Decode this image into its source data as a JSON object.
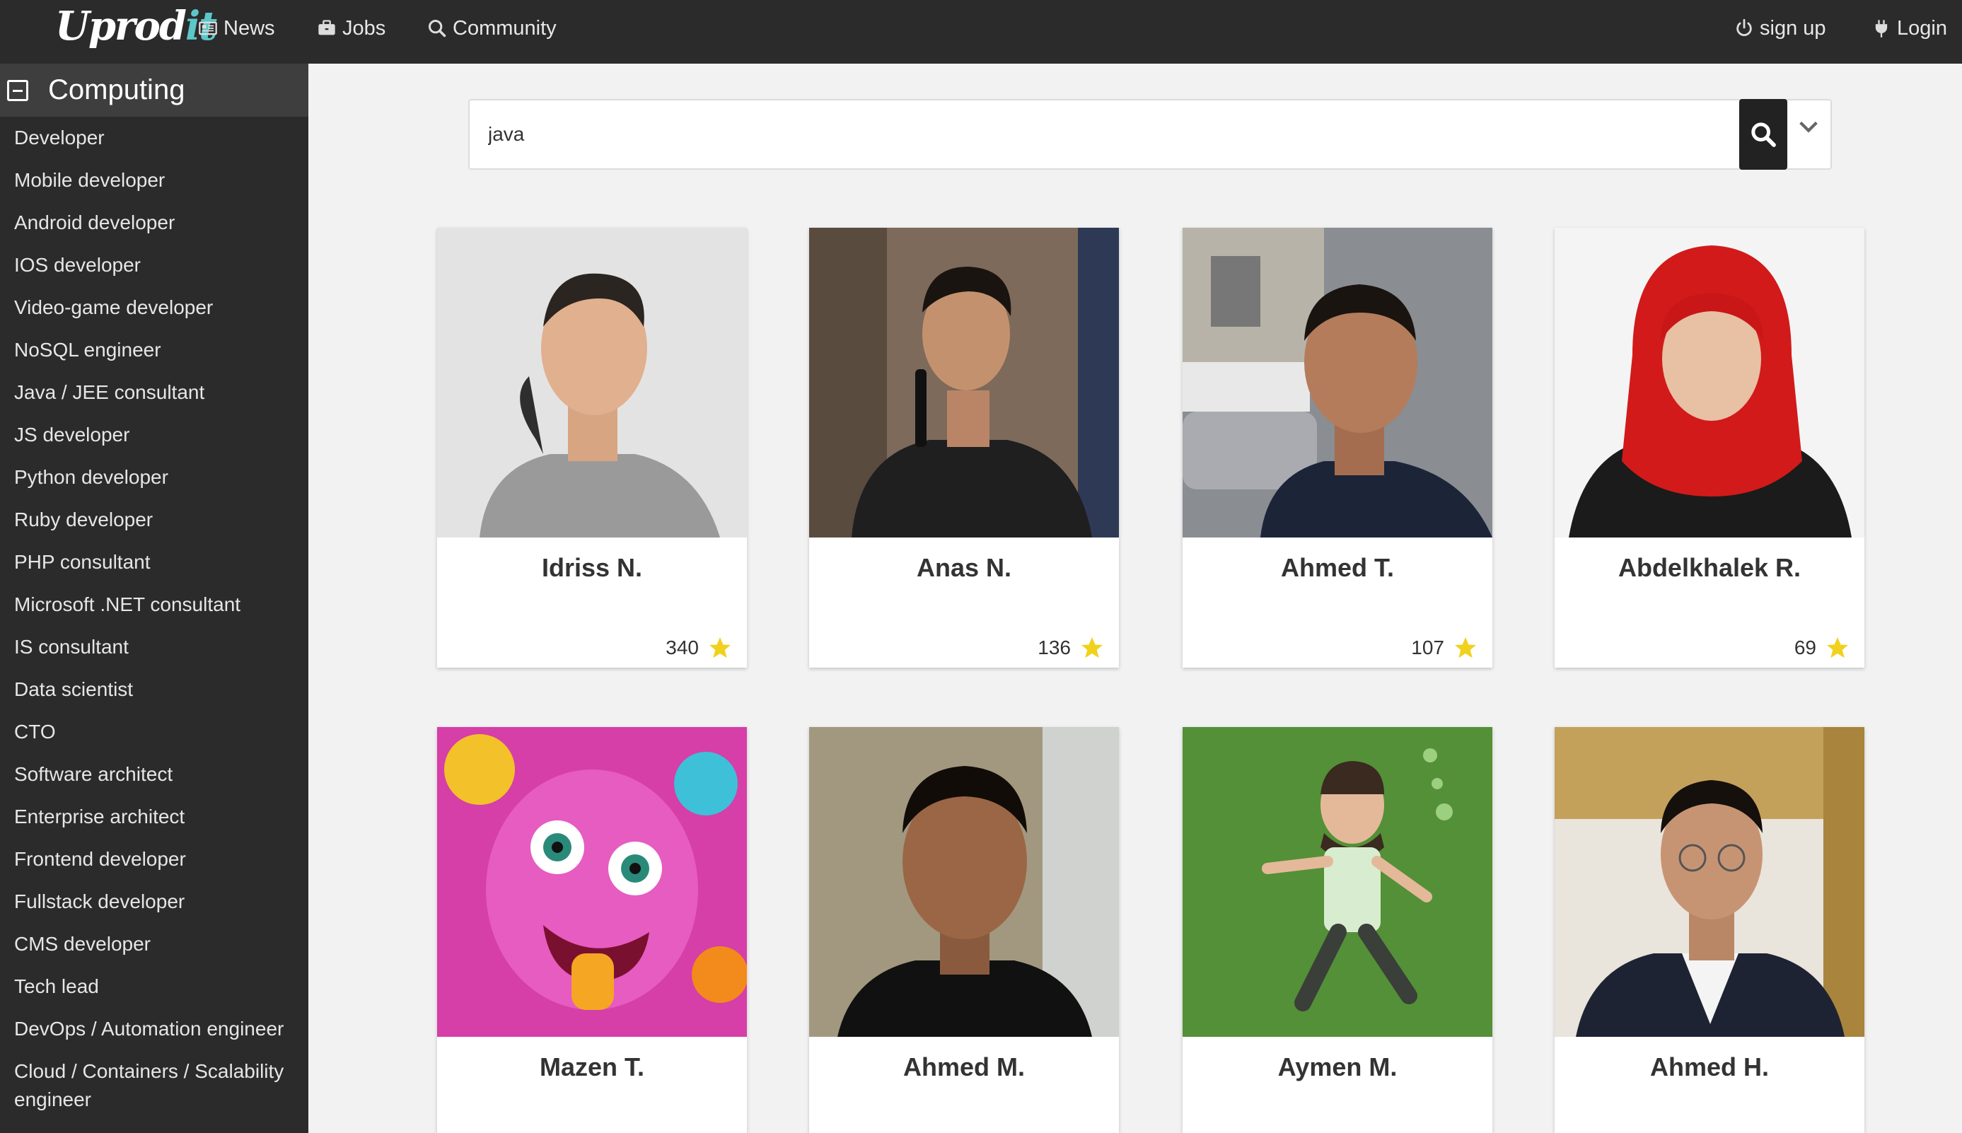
{
  "navbar": {
    "logo": "Uprod",
    "logo_suffix": "it",
    "news": "News",
    "jobs": "Jobs",
    "community": "Community",
    "signup": "sign up",
    "login": "Login"
  },
  "sidebar": {
    "title": "Computing",
    "items": [
      {
        "label": "Developer"
      },
      {
        "label": "Mobile developer"
      },
      {
        "label": "Android developer"
      },
      {
        "label": "IOS developer"
      },
      {
        "label": "Video-game developer"
      },
      {
        "label": "NoSQL engineer"
      },
      {
        "label": "Java / JEE consultant"
      },
      {
        "label": "JS developer"
      },
      {
        "label": "Python developer"
      },
      {
        "label": "Ruby developer"
      },
      {
        "label": "PHP consultant"
      },
      {
        "label": "Microsoft .NET consultant"
      },
      {
        "label": "IS consultant"
      },
      {
        "label": "Data scientist"
      },
      {
        "label": "CTO"
      },
      {
        "label": "Software architect"
      },
      {
        "label": "Enterprise architect"
      },
      {
        "label": "Frontend developer"
      },
      {
        "label": "Fullstack developer"
      },
      {
        "label": "CMS developer"
      },
      {
        "label": "Tech lead"
      },
      {
        "label": "DevOps / Automation engineer"
      },
      {
        "label": "Cloud / Containers / Scalability engineer"
      }
    ]
  },
  "search": {
    "value": "java"
  },
  "profiles": [
    {
      "name": "Idriss N.",
      "score": "340"
    },
    {
      "name": "Anas N.",
      "score": "136"
    },
    {
      "name": "Ahmed T.",
      "score": "107"
    },
    {
      "name": "Abdelkhalek R.",
      "score": "69"
    },
    {
      "name": "Mazen T."
    },
    {
      "name": "Ahmed M."
    },
    {
      "name": "Aymen M."
    },
    {
      "name": "Ahmed H."
    }
  ],
  "colors": {
    "navbar": "#2b2b2b",
    "sidebar": "#2b2b2b",
    "star": "#f0d21e"
  },
  "icons": {
    "news": "newspaper-icon",
    "jobs": "briefcase-icon",
    "community": "search-icon",
    "signup": "power-icon",
    "login": "plug-icon",
    "search": "search-icon",
    "toggle": "chevron-down-icon",
    "score": "star-icon"
  }
}
